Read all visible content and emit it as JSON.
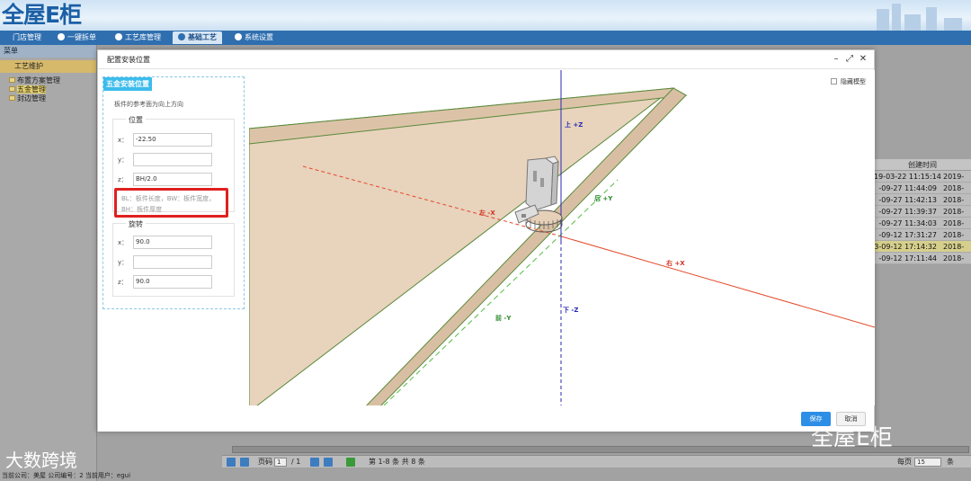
{
  "app": {
    "logo": "全屋E柜"
  },
  "nav": {
    "items": [
      {
        "label": "门店管理"
      },
      {
        "label": "一键拆单"
      },
      {
        "label": "工艺库管理"
      },
      {
        "label": "基础工艺"
      },
      {
        "label": "系统设置"
      }
    ],
    "active_index": 3
  },
  "sidebar": {
    "header": "菜单",
    "section": "工艺维护",
    "items": [
      {
        "label": "布置方案管理"
      },
      {
        "label": "五金管理"
      },
      {
        "label": "封边管理"
      }
    ]
  },
  "grid": {
    "header": "创建时间",
    "rows": [
      {
        "c1": "19-03-22 11:15:14",
        "c2": "2019-"
      },
      {
        "c1": "-09-27 11:44:09",
        "c2": "2018-"
      },
      {
        "c1": "-09-27 11:42:13",
        "c2": "2018-"
      },
      {
        "c1": "-09-27 11:39:37",
        "c2": "2018-"
      },
      {
        "c1": "-09-27 11:34:03",
        "c2": "2018-"
      },
      {
        "c1": "-09-12 17:31:27",
        "c2": "2018-"
      },
      {
        "c1": "3-09-12 17:14:32",
        "c2": "2018-"
      },
      {
        "c1": "-09-12 17:11:44",
        "c2": "2018-"
      }
    ],
    "highlight_row": 6
  },
  "pager": {
    "page_label": "页码",
    "page_value": "1",
    "page_total": "/ 1",
    "summary": "第 1-8 条  共 8 条",
    "per_page_label": "每页",
    "per_page_value": "15",
    "per_page_unit": "条"
  },
  "status": {
    "text": "当前公司：美屋  公司编号：2  当前用户：egui"
  },
  "watermarks": {
    "left": "大数跨境",
    "right": "全屋E柜"
  },
  "modal": {
    "title": "配置安装位置",
    "panel_label": "五金安装位置",
    "hint": "板件的参考面为向上方向",
    "position": {
      "legend": "位置",
      "x_label": "x：",
      "x_value": "-22.50",
      "y_label": "y：",
      "y_value": "",
      "z_label": "z：",
      "z_value": "BH/2.0"
    },
    "formula_hint_1": "BL：板件长度，BW：板件宽度，",
    "formula_hint_2": "BH：板件厚度",
    "rotation": {
      "legend": "旋转",
      "x_label": "x：",
      "x_value": "90.0",
      "y_label": "y：",
      "y_value": "",
      "z_label": "z：",
      "z_value": "90.0"
    },
    "hide_model_label": "隐藏模型",
    "axes": {
      "up": "上 +Z",
      "down": "下 -Z",
      "left": "左 -X",
      "right": "右 +X",
      "front": "前 -Y",
      "back": "后 +Y"
    },
    "save_label": "保存",
    "cancel_label": "取消"
  },
  "colors": {
    "board": "#e8d3bd",
    "board_edge": "#5a8a3a",
    "axis_z": "#2a2ab0",
    "axis_x": "#e34a2a",
    "axis_y": "#55bb44",
    "nav_bg": "#2f6fb0",
    "highlight_box": "#e02020",
    "save_button": "#2d8ee6"
  }
}
